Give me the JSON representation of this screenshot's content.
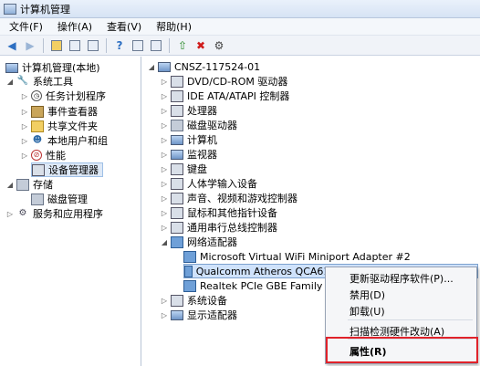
{
  "window": {
    "title": "计算机管理"
  },
  "menu": [
    "文件(F)",
    "操作(A)",
    "查看(V)",
    "帮助(H)"
  ],
  "left_tree": [
    {
      "label": "计算机管理(本地)",
      "icon": "computer-icon"
    },
    {
      "label": "系统工具",
      "icon": "tools-icon"
    },
    {
      "label": "任务计划程序",
      "icon": "clock-icon"
    },
    {
      "label": "事件查看器",
      "icon": "event-viewer-icon"
    },
    {
      "label": "共享文件夹",
      "icon": "shared-folder-icon"
    },
    {
      "label": "本地用户和组",
      "icon": "users-icon"
    },
    {
      "label": "性能",
      "icon": "performance-icon"
    },
    {
      "label": "设备管理器",
      "icon": "device-manager-icon"
    },
    {
      "label": "存储",
      "icon": "storage-icon"
    },
    {
      "label": "磁盘管理",
      "icon": "disk-icon"
    },
    {
      "label": "服务和应用程序",
      "icon": "services-icon"
    }
  ],
  "device_tree": {
    "root": "CNSZ-117524-01",
    "categories": [
      "DVD/CD-ROM 驱动器",
      "IDE ATA/ATAPI 控制器",
      "处理器",
      "磁盘驱动器",
      "计算机",
      "监视器",
      "键盘",
      "人体学输入设备",
      "声音、视频和游戏控制器",
      "鼠标和其他指针设备",
      "通用串行总线控制器",
      "网络适配器"
    ],
    "network_adapters": [
      "Microsoft Virtual WiFi Miniport Adapter #2",
      "Qualcomm Atheros QCA61x4 Wireless Network Adapter",
      "Realtek PCIe GBE Family Contr"
    ],
    "after": [
      "系统设备",
      "显示适配器"
    ]
  },
  "context_menu": {
    "update": "更新驱动程序软件(P)...",
    "disable": "禁用(D)",
    "uninstall": "卸载(U)",
    "scan": "扫描检测硬件改动(A)",
    "properties": "属性(R)"
  }
}
